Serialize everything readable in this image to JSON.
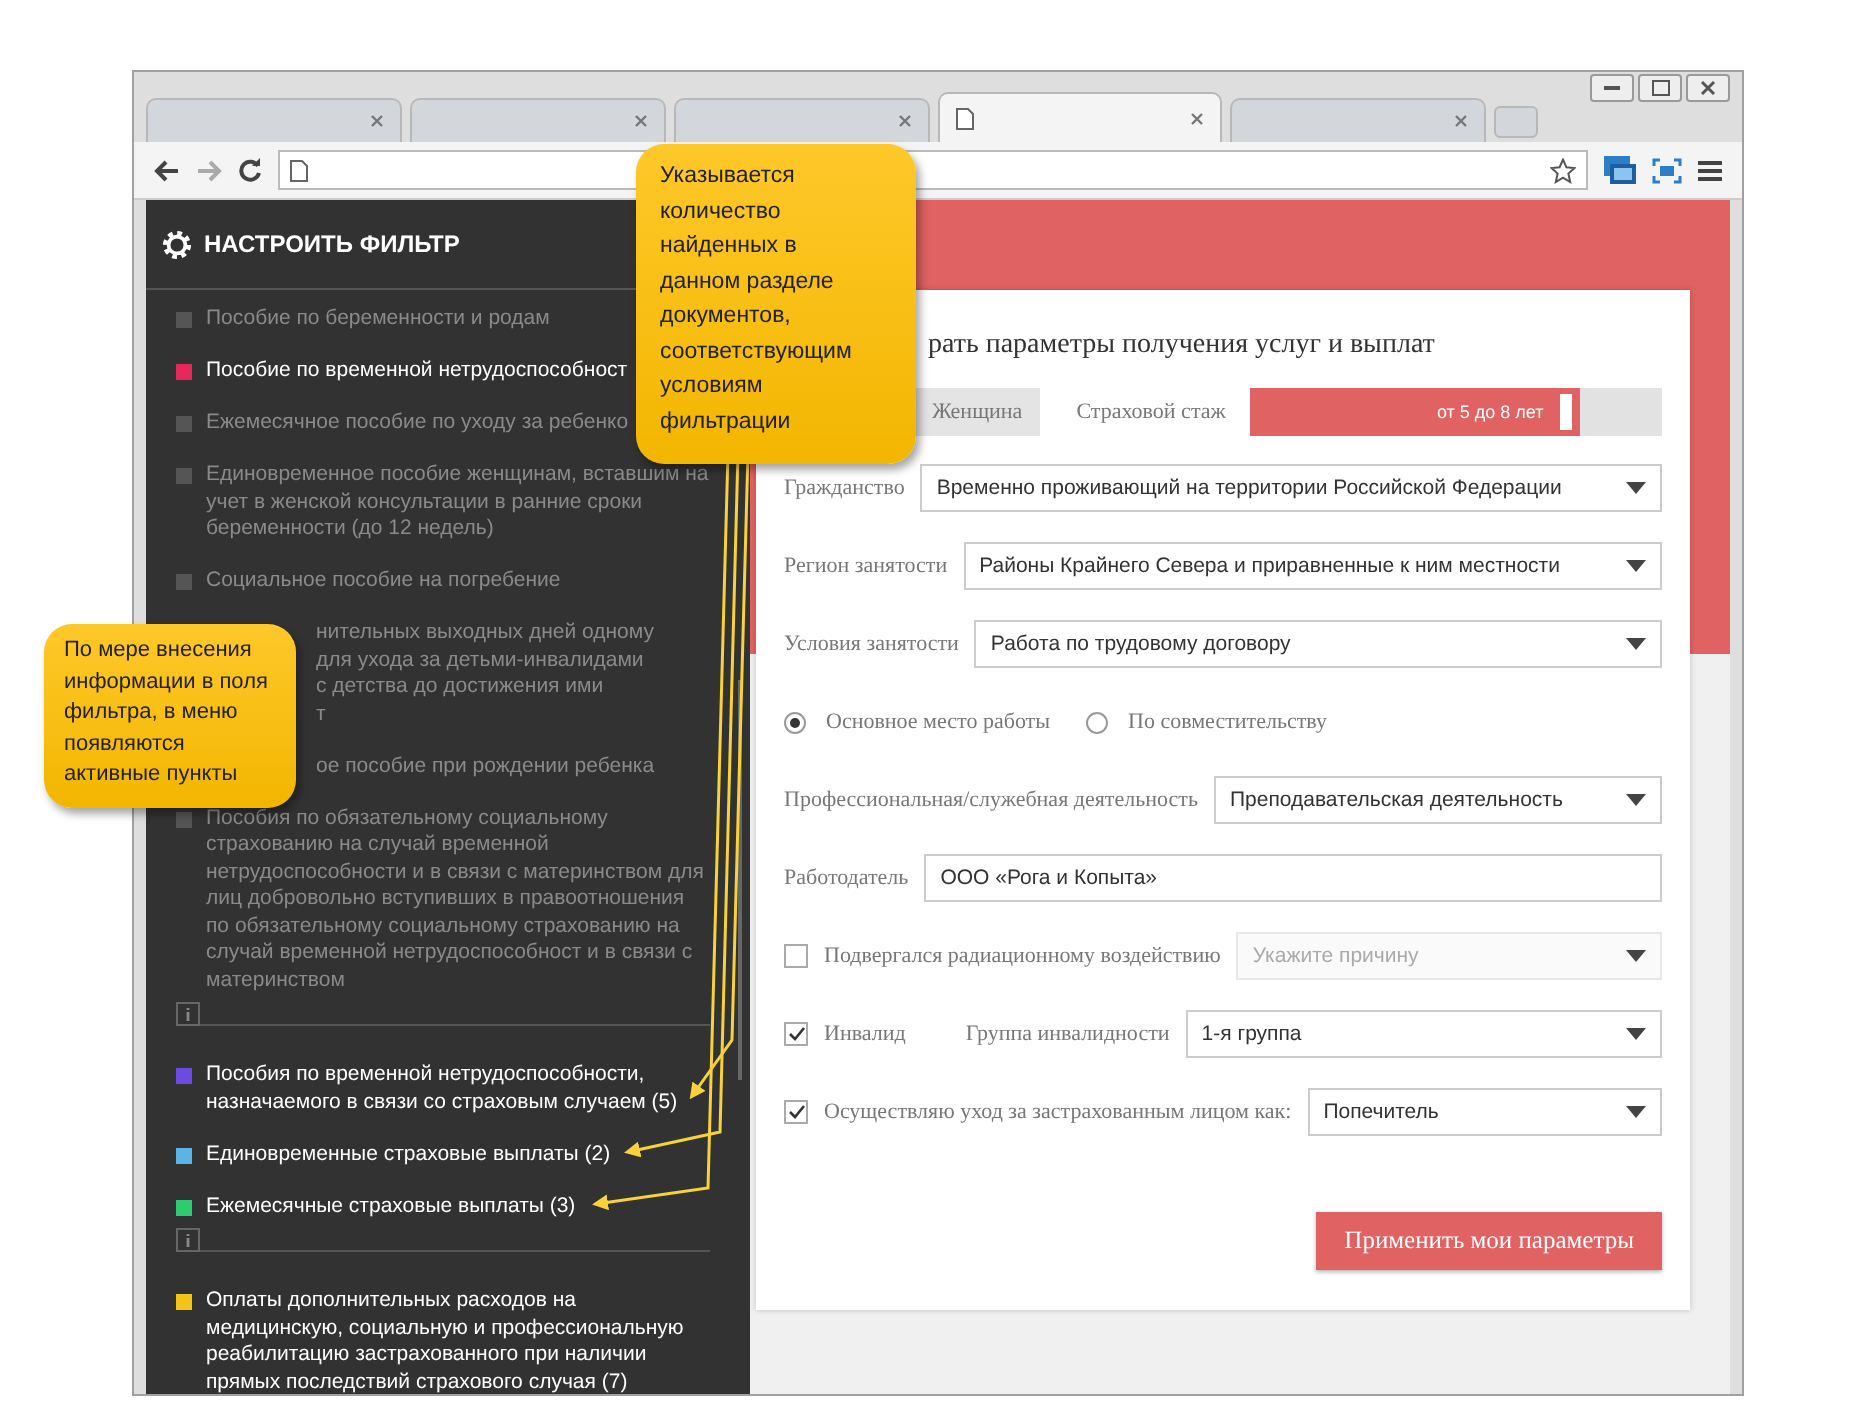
{
  "browser": {
    "tabs": [
      {
        "selected": false
      },
      {
        "selected": false
      },
      {
        "selected": false
      },
      {
        "selected": true
      },
      {
        "selected": false
      }
    ]
  },
  "sidebar": {
    "title": "НАСТРОИТЬ ФИЛЬТР",
    "groups": [
      {
        "items": [
          {
            "kind": "full",
            "text": "Пособие по беременности и родам",
            "active": false,
            "color": "#555555"
          },
          {
            "kind": "full",
            "text": "Пособие по временной нетрудоспособност",
            "active": true,
            "color": "#e8285a"
          },
          {
            "kind": "full",
            "text": "Ежемесячное пособие по уходу за ребенко",
            "active": false,
            "color": "#555555"
          },
          {
            "kind": "full",
            "text": "Единовременное пособие женщинам, вставшим на учет в женской консультации в ранние сроки беременности (до 12 недель)",
            "active": false,
            "color": "#555555"
          },
          {
            "kind": "full",
            "text": "Социальное пособие на погребение",
            "active": false,
            "color": "#555555"
          },
          {
            "kind": "partial",
            "lines": [
              "нительных выходных дней одному",
              "для ухода за детьми-инвалидами",
              "с детства до достижения ими",
              "т"
            ],
            "active": false
          },
          {
            "kind": "partial",
            "lines": [
              "ое пособие при рождении ребенка"
            ],
            "active": false
          },
          {
            "kind": "full",
            "text": "Пособия по обязательному социальному страхованию на случай временной нетрудоспособности и в связи с материнством для лиц добровольно вступивших в правоотношения по обязательному социальному страхованию на случай временной нетрудоспособност и в связи с материнством",
            "active": false,
            "color": "#555555"
          }
        ]
      },
      {
        "items": [
          {
            "kind": "full",
            "text": "Пособия по временной нетрудоспособности, назначаемого в связи со страховым случаем (5)",
            "active": true,
            "color": "#6a4de0"
          },
          {
            "kind": "full",
            "text": "Единовременные страховые выплаты (2)",
            "active": true,
            "color": "#5ab4e6"
          },
          {
            "kind": "full",
            "text": "Ежемесячные страховые выплаты (3)",
            "active": true,
            "color": "#2ecc71"
          }
        ]
      },
      {
        "items": [
          {
            "kind": "full",
            "text": "Оплаты дополнительных расходов на медицинскую, социальную и профессиональную реабилитацию застрахованного при наличии прямых последствий страхового случая (7)",
            "active": true,
            "color": "#f3c316"
          }
        ]
      }
    ]
  },
  "form": {
    "title": "рать параметры получения услуг и выплат",
    "gender_options": [
      {
        "label": "Женщина",
        "selected": false
      }
    ],
    "experience": {
      "label": "Страховой стаж",
      "value": "от 5 до 8 лет",
      "level": 0.8
    },
    "fields": [
      {
        "kind": "select",
        "label": "Гражданство",
        "value": "Временно проживающий на территории Российской Федерации",
        "disabled": false
      },
      {
        "kind": "select",
        "label": "Регион занятости",
        "value": "Районы Крайнего Севера и приравненные к ним местности",
        "disabled": false
      },
      {
        "kind": "select",
        "label": "Условия занятости",
        "value": "Работа по трудовому договору",
        "disabled": false
      },
      {
        "kind": "radio",
        "options": [
          {
            "label": "Основное место работы",
            "selected": true
          },
          {
            "label": "По совместительству",
            "selected": false
          }
        ]
      },
      {
        "kind": "select",
        "label": "Профессиональная/служебная деятельность",
        "value": "Преподавательская деятельность",
        "disabled": false
      },
      {
        "kind": "text",
        "label": "Работодатель",
        "value": "ООО «Рога и Копыта»"
      },
      {
        "kind": "check",
        "label": "Подвергался радиационному воздействию",
        "checked": false,
        "select": {
          "placeholder": "Укажите причину",
          "disabled": true
        }
      },
      {
        "kind": "check",
        "label": "Инвалид",
        "checked": true,
        "sublabel": "Группа инвалидности",
        "select": {
          "value": "1-я группа",
          "disabled": false
        }
      },
      {
        "kind": "check",
        "label": "Осуществляю уход за застрахованным лицом как:",
        "checked": true,
        "select": {
          "value": "Попечитель",
          "disabled": false
        }
      }
    ],
    "submit": "Применить мои параметры"
  },
  "callouts": [
    {
      "text": "Указывается количество найденных в данном разделе документов, соответствующим условиям фильтрации"
    },
    {
      "text": "По мере внесения информации в поля фильтра, в меню появляются активные пункты"
    }
  ]
}
